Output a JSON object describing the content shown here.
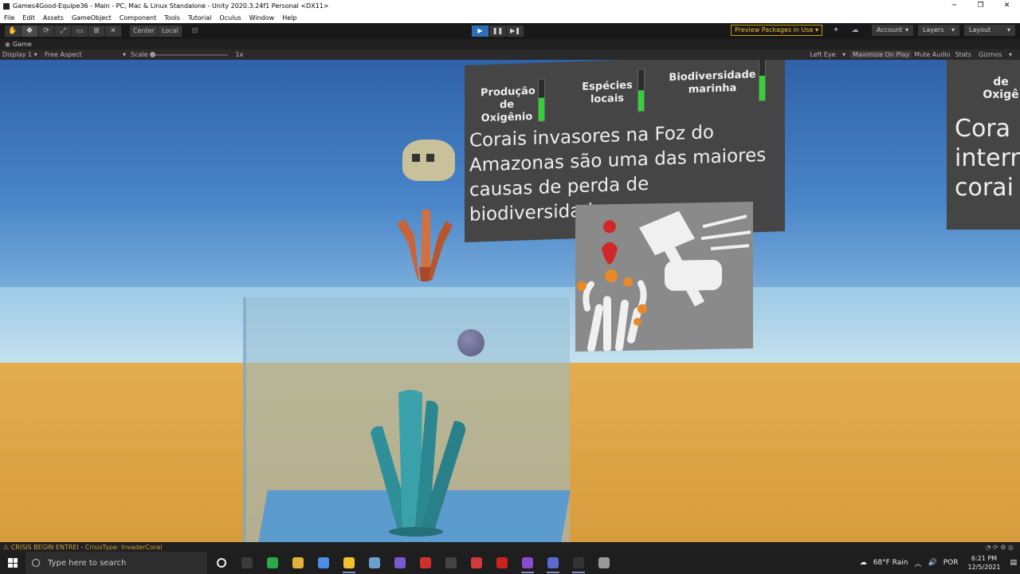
{
  "window": {
    "title": "Games4Good-Equipe36 - Main - PC, Mac & Linux Standalone - Unity 2020.3.24f1 Personal <DX11>",
    "minimize": "─",
    "maximize": "❐",
    "close": "✕"
  },
  "menu": [
    "File",
    "Edit",
    "Assets",
    "GameObject",
    "Component",
    "Tools",
    "Tutorial",
    "Oculus",
    "Window",
    "Help"
  ],
  "toolbar": {
    "tools": [
      "✋",
      "✥",
      "⟳",
      "⤢",
      "▭",
      "⊞",
      "✕"
    ],
    "pivot_center": "Center",
    "pivot_local": "Local",
    "snap": "⊟",
    "play": "▶",
    "pause": "❚❚",
    "step": "▶❚",
    "preview_packages": "Preview Packages in Use ▾",
    "account": "Account",
    "layers": "Layers",
    "layout": "Layout",
    "dropdown_arrow": "▾"
  },
  "game_tab": {
    "label": "Game"
  },
  "game_bar": {
    "display": "Display 1",
    "aspect": "Free Aspect",
    "scale_label": "Scale",
    "scale_value": "1x",
    "left_eye": "Left Eye",
    "maximize": "Maximize On Play",
    "mute": "Mute Audio",
    "stats": "Stats",
    "gizmos": "Gizmos"
  },
  "hud": {
    "meters": [
      {
        "label": "Produção de Oxigênio",
        "level": 0.55
      },
      {
        "label": "Espécies locais",
        "level": 0.5
      },
      {
        "label": "Biodiversidade marinha",
        "level": 0.6
      }
    ],
    "message": "Corais invasores na Foz do Amazonas são uma das maiores causas de perda de biodiversidade...",
    "side_top": "de Oxigê",
    "side_text": "Cora intern corai"
  },
  "console": {
    "message": "⚠ CRISIS BEGIN ENTREI - CrisisType: InvaderCoral"
  },
  "taskbar": {
    "search_placeholder": "Type here to search",
    "weather": "68°F  Rain",
    "lang": "POR",
    "time": "6:21 PM",
    "date": "12/5/2021",
    "apps": [
      "#3a3a3a",
      "#2aa84a",
      "#e3b23c",
      "#4b8ee6",
      "#f2c12e",
      "#6aa0d0",
      "#7a5ad0",
      "#d03030",
      "#444",
      "#d03a3a",
      "#c22",
      "#8a4ad0",
      "#5a6ad0",
      "#333",
      "#999"
    ]
  }
}
